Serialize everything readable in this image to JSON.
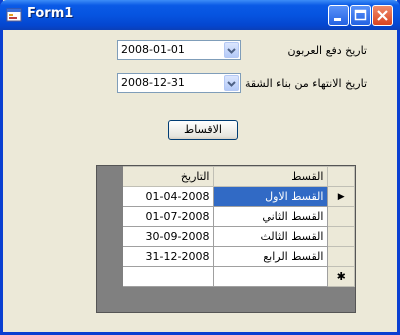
{
  "window": {
    "title": "Form1"
  },
  "form": {
    "down_payment_label": "تاريخ دفع العربون",
    "down_payment_value": "2008-01-01",
    "end_date_label": "تاريخ الانتهاء من بناء الشقة",
    "end_date_value": "2008-12-31",
    "installments_button": "الاقساط"
  },
  "grid": {
    "columns": [
      "القسط",
      "التاريخ"
    ],
    "rows": [
      {
        "name": "القسط الاول",
        "date": "01-04-2008"
      },
      {
        "name": "القسط الثاني",
        "date": "01-07-2008"
      },
      {
        "name": "القسط الثالث",
        "date": "30-09-2008"
      },
      {
        "name": "القسط الرابع",
        "date": "31-12-2008"
      }
    ],
    "current_row_marker": "▶",
    "new_row_marker": "✱"
  },
  "colors": {
    "title_bar": "#0a5ae6",
    "selection": "#316ac5",
    "window_bg": "#ece9d8"
  }
}
